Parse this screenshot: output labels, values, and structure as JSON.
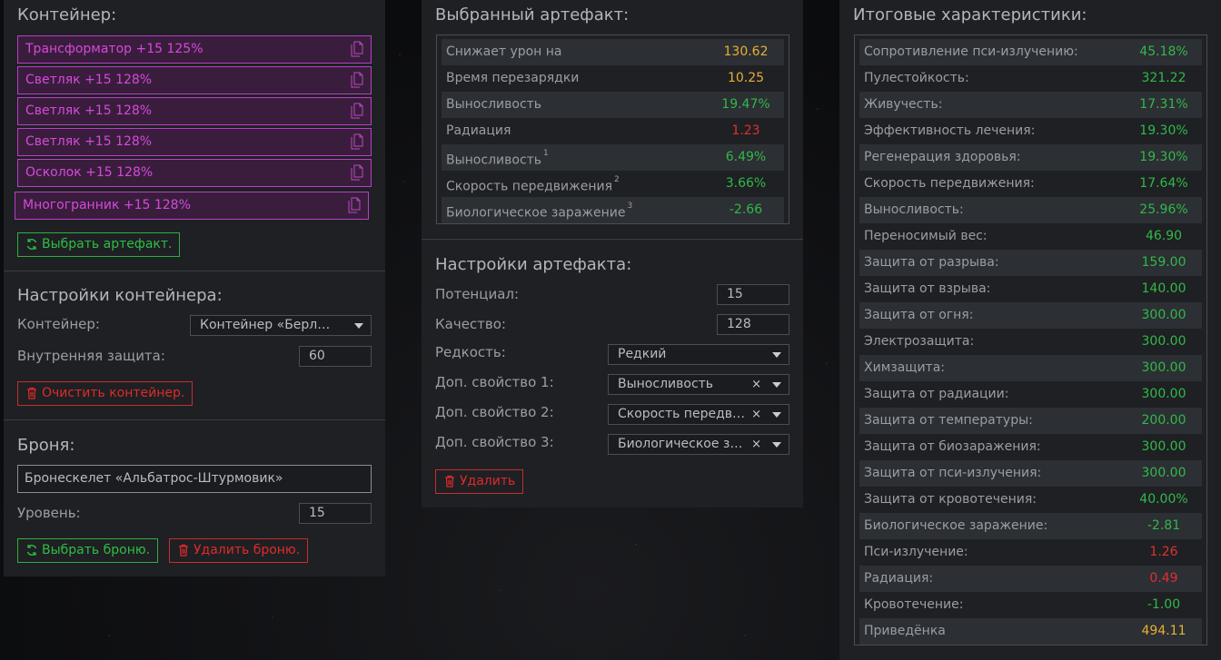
{
  "container_panel": {
    "title": "Контейнер:",
    "items": [
      "Трансформатор +15 125%",
      "Светляк +15 128%",
      "Светляк +15 128%",
      "Светляк +15 128%",
      "Осколок +15 128%",
      "Многогранник +15 128%"
    ],
    "select_artifact_label": "Выбрать артефакт.",
    "settings_title": "Настройки контейнера:",
    "container_label": "Контейнер:",
    "container_value": "Контейнер «Берлога…",
    "inner_protection_label": "Внутренняя защита:",
    "inner_protection_value": "60",
    "clear_label": "Очистить контейнер."
  },
  "armor_panel": {
    "title": "Броня:",
    "armor_name": "Бронескелет «Альбатрос-Штурмовик»",
    "level_label": "Уровень:",
    "level_value": "15",
    "select_label": "Выбрать броню.",
    "delete_label": "Удалить броню."
  },
  "selected_artifact": {
    "title": "Выбранный артефакт:",
    "rows": [
      {
        "label": "Снижает урон на",
        "sup": "",
        "value": "130.62",
        "color": "yellow"
      },
      {
        "label": "Время перезарядки",
        "sup": "",
        "value": "10.25",
        "color": "yellow"
      },
      {
        "label": "Выносливость",
        "sup": "",
        "value": "19.47%",
        "color": "green"
      },
      {
        "label": "Радиация",
        "sup": "",
        "value": "1.23",
        "color": "red"
      },
      {
        "label": "Выносливость",
        "sup": "1",
        "value": "6.49%",
        "color": "green"
      },
      {
        "label": "Скорость передвижения",
        "sup": "2",
        "value": "3.66%",
        "color": "green"
      },
      {
        "label": "Биологическое заражение",
        "sup": "3",
        "value": "-2.66",
        "color": "green"
      }
    ]
  },
  "artifact_settings": {
    "title": "Настройки артефакта:",
    "potential_label": "Потенциал:",
    "potential_value": "15",
    "quality_label": "Качество:",
    "quality_value": "128",
    "rarity_label": "Редкость:",
    "rarity_value": "Редкий",
    "extra1_label": "Доп. свойство 1:",
    "extra1_value": "Выносливость",
    "extra2_label": "Доп. свойство 2:",
    "extra2_value": "Скорость передви…",
    "extra3_label": "Доп. свойство 3:",
    "extra3_value": "Биологическое за…",
    "clear_glyph": "×",
    "delete_label": "Удалить"
  },
  "total_stats": {
    "title": "Итоговые характеристики:",
    "rows": [
      {
        "label": "Сопротивление пси-излучению:",
        "value": "45.18%",
        "color": "green"
      },
      {
        "label": "Пулестойкость:",
        "value": "321.22",
        "color": "green"
      },
      {
        "label": "Живучесть:",
        "value": "17.31%",
        "color": "green"
      },
      {
        "label": "Эффективность лечения:",
        "value": "19.30%",
        "color": "green"
      },
      {
        "label": "Регенерация здоровья:",
        "value": "19.30%",
        "color": "green"
      },
      {
        "label": "Скорость передвижения:",
        "value": "17.64%",
        "color": "green"
      },
      {
        "label": "Выносливость:",
        "value": "25.96%",
        "color": "green"
      },
      {
        "label": "Переносимый вес:",
        "value": "46.90",
        "color": "green"
      },
      {
        "label": "Защита от разрыва:",
        "value": "159.00",
        "color": "green"
      },
      {
        "label": "Защита от взрыва:",
        "value": "140.00",
        "color": "green"
      },
      {
        "label": "Защита от огня:",
        "value": "300.00",
        "color": "green"
      },
      {
        "label": "Электрозащита:",
        "value": "300.00",
        "color": "green"
      },
      {
        "label": "Химзащита:",
        "value": "300.00",
        "color": "green"
      },
      {
        "label": "Защита от радиации:",
        "value": "300.00",
        "color": "green"
      },
      {
        "label": "Защита от температуры:",
        "value": "200.00",
        "color": "green"
      },
      {
        "label": "Защита от биозаражения:",
        "value": "300.00",
        "color": "green"
      },
      {
        "label": "Защита от пси-излучения:",
        "value": "300.00",
        "color": "green"
      },
      {
        "label": "Защита от кровотечения:",
        "value": "40.00%",
        "color": "green"
      },
      {
        "label": "Биологическое заражение:",
        "value": "-2.81",
        "color": "green"
      },
      {
        "label": "Пси-излучение:",
        "value": "1.26",
        "color": "red"
      },
      {
        "label": "Радиация:",
        "value": "0.49",
        "color": "red"
      },
      {
        "label": "Кровотечение:",
        "value": "-1.00",
        "color": "green"
      },
      {
        "label": "Приведёнка",
        "value": "494.11",
        "color": "yellow"
      }
    ]
  },
  "colors": {
    "green": "#32b84a",
    "yellow": "#e6b034",
    "red": "#e03030",
    "purple": "#d44ad8"
  },
  "icons": {
    "item_action": "document-copy-icon",
    "select": "refresh-icon",
    "delete": "trash-icon"
  }
}
